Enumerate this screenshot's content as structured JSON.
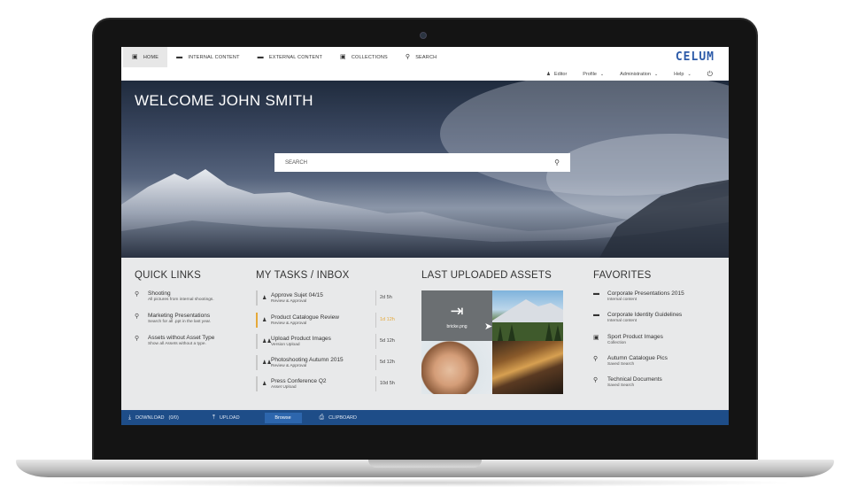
{
  "nav": {
    "tabs": [
      {
        "label": "HOME",
        "icon": "monitor-icon"
      },
      {
        "label": "INTERNAL CONTENT",
        "icon": "folder-icon"
      },
      {
        "label": "EXTERNAL CONTENT",
        "icon": "folder-icon"
      },
      {
        "label": "COLLECTIONS",
        "icon": "briefcase-icon"
      },
      {
        "label": "SEARCH",
        "icon": "search-icon"
      }
    ],
    "logo": "CELUM"
  },
  "subnav": {
    "user": "Editor",
    "profile": "Profile",
    "administration": "Administration",
    "help": "Help"
  },
  "hero": {
    "title": "WELCOME JOHN SMITH",
    "search_placeholder": "SEARCH"
  },
  "quick_links": {
    "title": "QUICK LINKS",
    "items": [
      {
        "title": "Shooting",
        "sub": "All pictures from internal shootings."
      },
      {
        "title": "Marketing Presentations",
        "sub": "Search for all .ppt in the last year."
      },
      {
        "title": "Assets without Asset Type",
        "sub": "Show all Assets without a type."
      }
    ]
  },
  "tasks": {
    "title": "MY TASKS / INBOX",
    "items": [
      {
        "title": "Approve Sujet 04/15",
        "sub": "Review & Approval",
        "due": "2d 5h"
      },
      {
        "title": "Product Catalogue Review",
        "sub": "Review & Approval",
        "due": "1d 12h"
      },
      {
        "title": "Upload Product Images",
        "sub": "Version Upload",
        "due": "5d 12h"
      },
      {
        "title": "Photoshooting Autumn 2015",
        "sub": "Review & Approval",
        "due": "5d 12h"
      },
      {
        "title": "Press Conference Q2",
        "sub": "Asset Upload",
        "due": "10d 5h"
      }
    ]
  },
  "assets": {
    "title": "LAST UPLOADED ASSETS",
    "upload_name": "bricke.png"
  },
  "favorites": {
    "title": "FAVORITES",
    "items": [
      {
        "title": "Corporate Presentations 2015",
        "sub": "Internal content"
      },
      {
        "title": "Corporate Identity Guidelines",
        "sub": "Internal content"
      },
      {
        "title": "Sport Product Images",
        "sub": "Collection"
      },
      {
        "title": "Autumn Catalogue Pics",
        "sub": "Saved Search"
      },
      {
        "title": "Technical Documents",
        "sub": "Saved Search"
      }
    ]
  },
  "bottombar": {
    "download": "DOWNLOAD",
    "download_count": "(0/0)",
    "upload": "UPLOAD",
    "browse": "Browse",
    "clipboard": "CLIPBOARD"
  },
  "colors": {
    "brand": "#2c5aa8",
    "bottombar": "#1e4d88",
    "highlight": "#e5a93a"
  }
}
